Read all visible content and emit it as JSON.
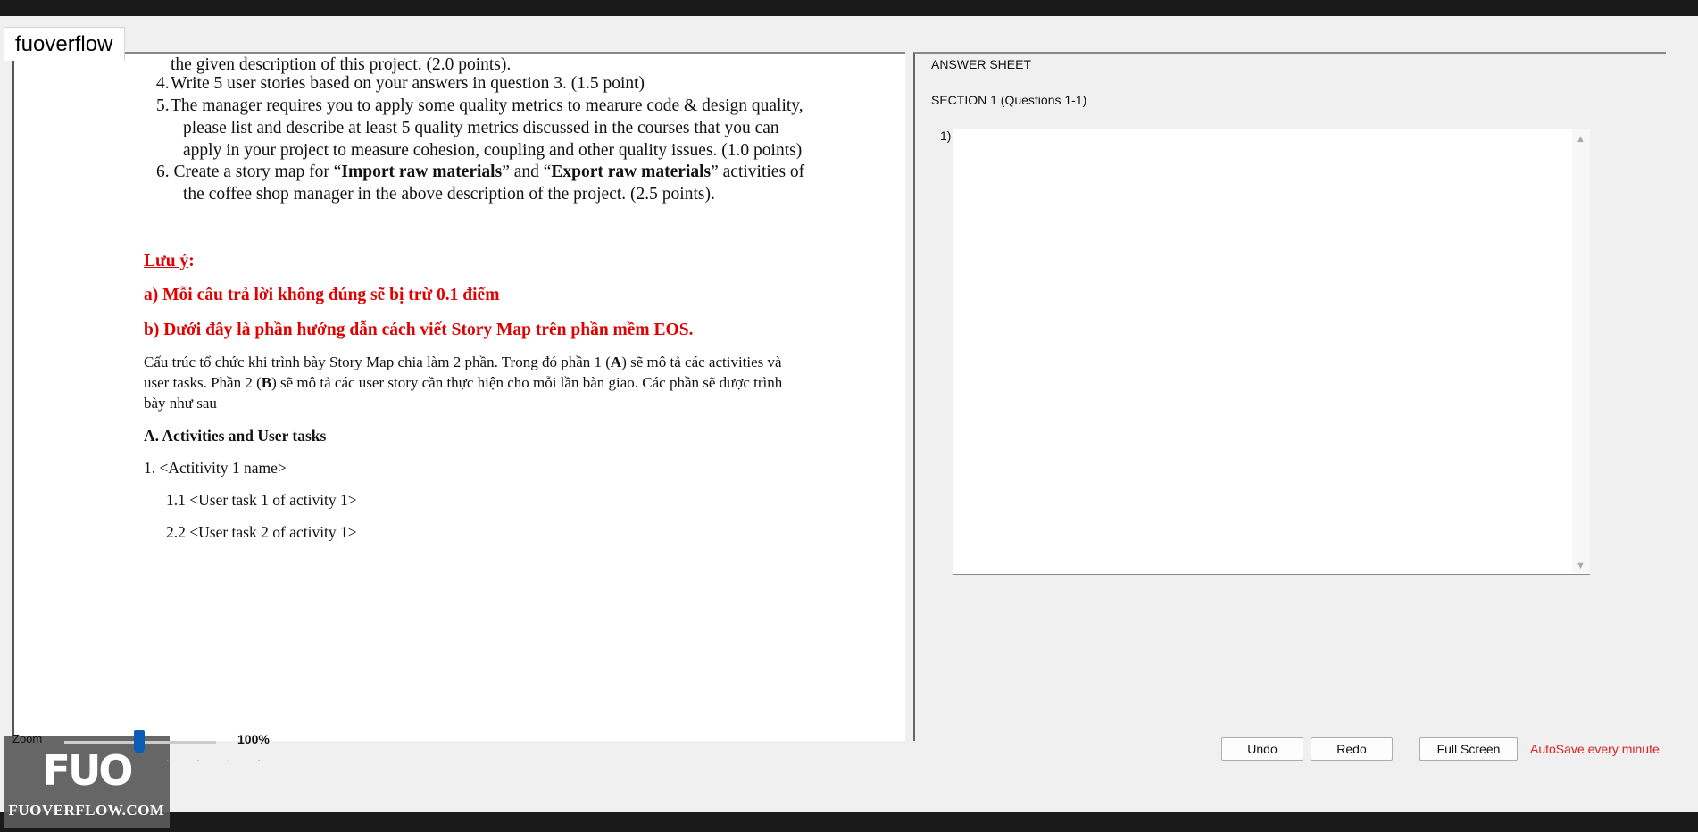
{
  "brand": {
    "tab_label": "fuoverflow"
  },
  "document": {
    "lines": [
      "the given description of this project. (2.0 points).",
      "4.",
      "Write 5 user stories based on your answers in question 3. (1.5 point)",
      "5.",
      "The manager requires you to apply some quality metrics to mearure code & design quality,",
      "please list and describe at least 5 quality metrics discussed in the courses that you can",
      "apply in your project to measure cohesion, coupling and other quality issues. (1.0 points)",
      "6.",
      "Create a story map for “",
      "Import raw materials",
      "” and “",
      "Export raw materials",
      "” activities of",
      "the coffee shop manager in the above description of the project. (2.5 points)."
    ],
    "note_title": "Lưu ý",
    "note_colon": ":",
    "note_a": "a) Mỗi câu trả lời không đúng sẽ bị trừ 0.1 điểm",
    "note_b": "b) Dưới đây là phần hướng dẫn cách viết Story Map trên phần mềm EOS.",
    "para1_a": "Cấu trúc tổ chức khi trình bày Story Map chia làm 2 phần.  Trong đó phần 1 (",
    "para1_A": "A",
    "para1_b": ") sẽ mô tả các activities và",
    "para2_a": "user tasks. Phần 2 (",
    "para2_B": "B",
    "para2_b": ") sẽ mô tả các user story cần thực hiện cho mỗi lần bàn giao. Các phần sẽ được trình",
    "para3": "bày như sau",
    "heading_a": "A. Activities and User tasks",
    "activity_1": "1. <Actitivity 1 name>",
    "task_1": "1.1 <User task 1 of activity 1>",
    "task_2": "2.2 <User task 2 of activity 1>"
  },
  "answer": {
    "title": "ANSWER SHEET",
    "section": "SECTION 1 (Questions 1-1)",
    "q_label": "1)",
    "value": ""
  },
  "zoom": {
    "label": "Zoom",
    "value": "100%",
    "level_percent": 100
  },
  "logo": {
    "big": "FUO",
    "small": "FUOVERFLOW.COM"
  },
  "buttons": {
    "undo": "Undo",
    "redo": "Redo",
    "fullscreen": "Full Screen"
  },
  "autosave": "AutoSave every minute",
  "colors": {
    "warning_red": "#e00000",
    "zoom_thumb": "#0c5cb5"
  }
}
